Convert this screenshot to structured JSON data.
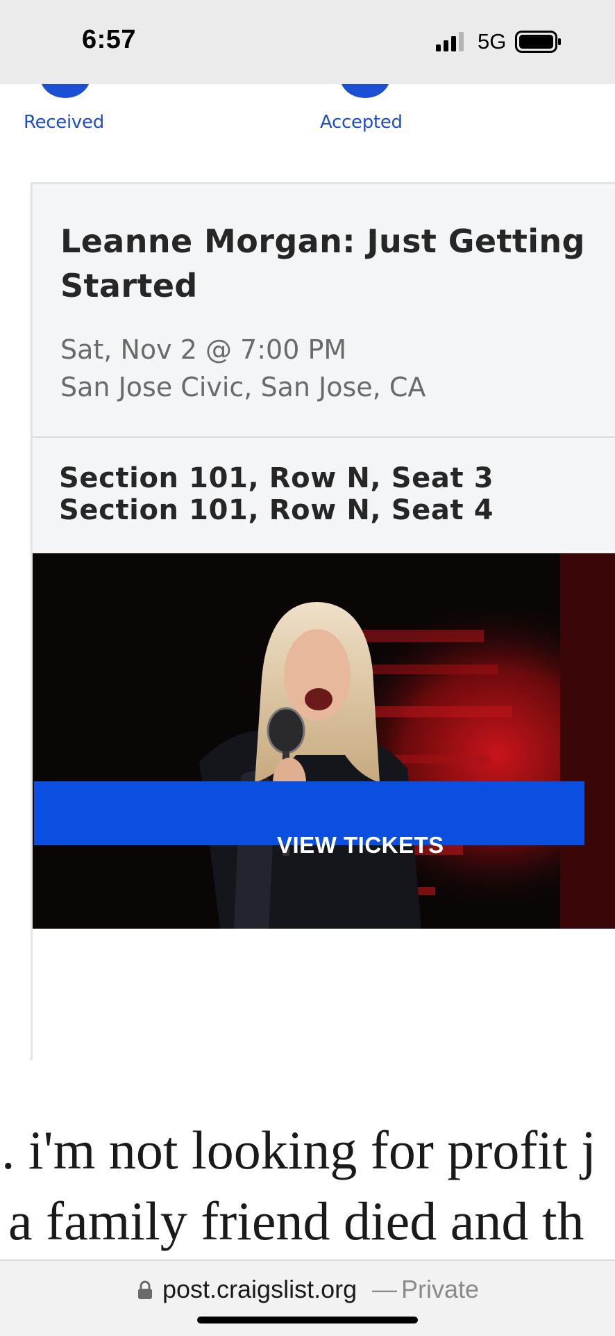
{
  "status_bar": {
    "time": "6:57",
    "network": "5G",
    "signal_icon": "cellular-signal-icon",
    "battery_icon": "battery-full-icon"
  },
  "tracker": {
    "steps": [
      {
        "label": "Received"
      },
      {
        "label": "Accepted"
      }
    ],
    "accent_color": "#1a4fd6"
  },
  "ticket": {
    "title": "Leanne Morgan: Just Getting Started",
    "datetime": "Sat, Nov 2 @ 7:00 PM",
    "venue": "San Jose Civic, San Jose, CA",
    "seats": [
      "Section 101, Row N, Seat 3",
      "Section 101, Row N, Seat 4"
    ],
    "view_button_label": "VIEW TICKETS",
    "button_color": "#0a4fe0"
  },
  "post": {
    "lines": [
      ". i'm not looking for profit j",
      "a family friend died and th"
    ]
  },
  "browser": {
    "domain": "post.craigslist.org",
    "separator": "—",
    "mode": "Private",
    "lock_icon": "lock-icon"
  }
}
